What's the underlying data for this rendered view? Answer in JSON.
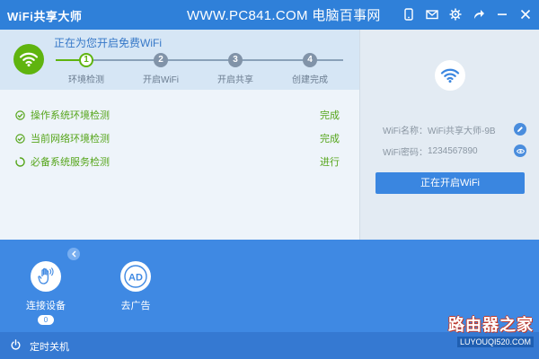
{
  "app": {
    "title": "WiFi共享大师"
  },
  "watermark_top": "WWW.PC841.COM 电脑百事网",
  "titlebar_icons": [
    "phone-icon",
    "mail-icon",
    "gear-icon",
    "share-icon",
    "minimize-icon",
    "close-icon"
  ],
  "progress": {
    "title": "正在为您开启免费WiFi",
    "steps": [
      {
        "num": "1",
        "label": "环境检测"
      },
      {
        "num": "2",
        "label": "开启WiFi"
      },
      {
        "num": "3",
        "label": "开启共享"
      },
      {
        "num": "4",
        "label": "创建完成"
      }
    ]
  },
  "checks": [
    {
      "label": "操作系统环境检测",
      "status": "完成"
    },
    {
      "label": "当前网络环境检测",
      "status": "完成"
    },
    {
      "label": "必备系统服务检测",
      "status": "进行"
    }
  ],
  "wifi_info": {
    "name_label": "WiFi名称：",
    "name_value": "WiFi共享大师-9B",
    "password_label": "WiFi密码：",
    "password_value": "1234567890",
    "start_button": "正在开启WiFi"
  },
  "tools": [
    {
      "label": "连接设备",
      "count": "0"
    },
    {
      "label": "去广告",
      "icon_text": "AD"
    }
  ],
  "footer": {
    "label": "定时关机"
  },
  "brand": {
    "title": "路由器之家",
    "url": "LUYOUQI520.COM"
  },
  "colors": {
    "titlebar": "#2f80d9",
    "accent_green": "#5fb40f",
    "tool_bg": "#3f89e3",
    "button": "#3a86e0"
  }
}
